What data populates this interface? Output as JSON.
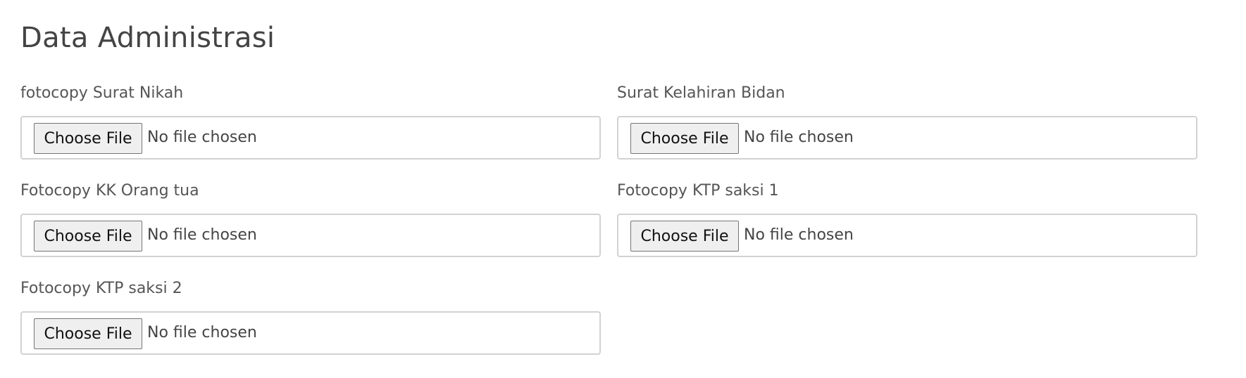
{
  "page": {
    "title": "Data Administrasi"
  },
  "fields": [
    {
      "label": "fotocopy Surat Nikah",
      "button_label": "Choose File",
      "status": "No file chosen"
    },
    {
      "label": "Surat Kelahiran Bidan",
      "button_label": "Choose File",
      "status": "No file chosen"
    },
    {
      "label": "Fotocopy KK Orang tua",
      "button_label": "Choose File",
      "status": "No file chosen"
    },
    {
      "label": "Fotocopy KTP saksi 1",
      "button_label": "Choose File",
      "status": "No file chosen"
    },
    {
      "label": "Fotocopy KTP saksi 2",
      "button_label": "Choose File",
      "status": "No file chosen"
    }
  ]
}
